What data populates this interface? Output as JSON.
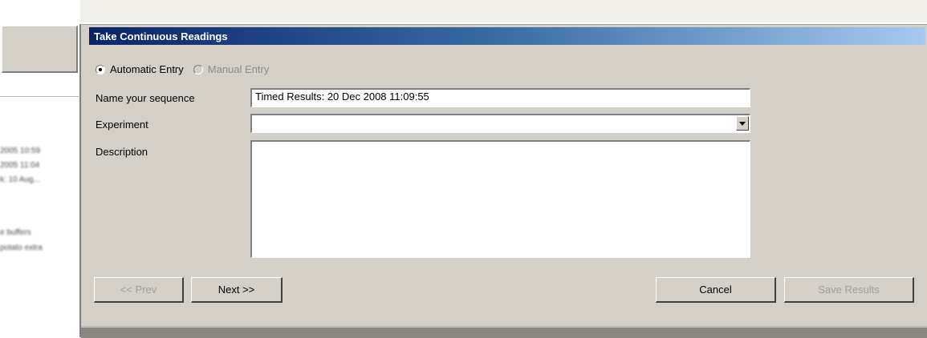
{
  "dialog": {
    "title": "Take Continuous Readings",
    "entry_mode": {
      "automatic_label": "Automatic Entry",
      "manual_label": "Manual Entry",
      "selected": "automatic"
    },
    "fields": {
      "sequence_label": "Name your sequence",
      "sequence_value": "Timed Results: 20 Dec 2008 11:09:55",
      "experiment_label": "Experiment",
      "experiment_value": "",
      "description_label": "Description",
      "description_value": ""
    },
    "buttons": {
      "prev": "<< Prev",
      "next": "Next >>",
      "cancel": "Cancel",
      "save": "Save Results"
    }
  },
  "background": {
    "blurred_lines": [
      "2005 10:59",
      "2005 11:04",
      "k: 10 Aug...",
      "e buffers",
      "potato extra"
    ]
  },
  "colors": {
    "dialog_bg": "#d4d0c8",
    "title_gradient_start": "#0a246a",
    "title_gradient_end": "#a6caf0"
  }
}
